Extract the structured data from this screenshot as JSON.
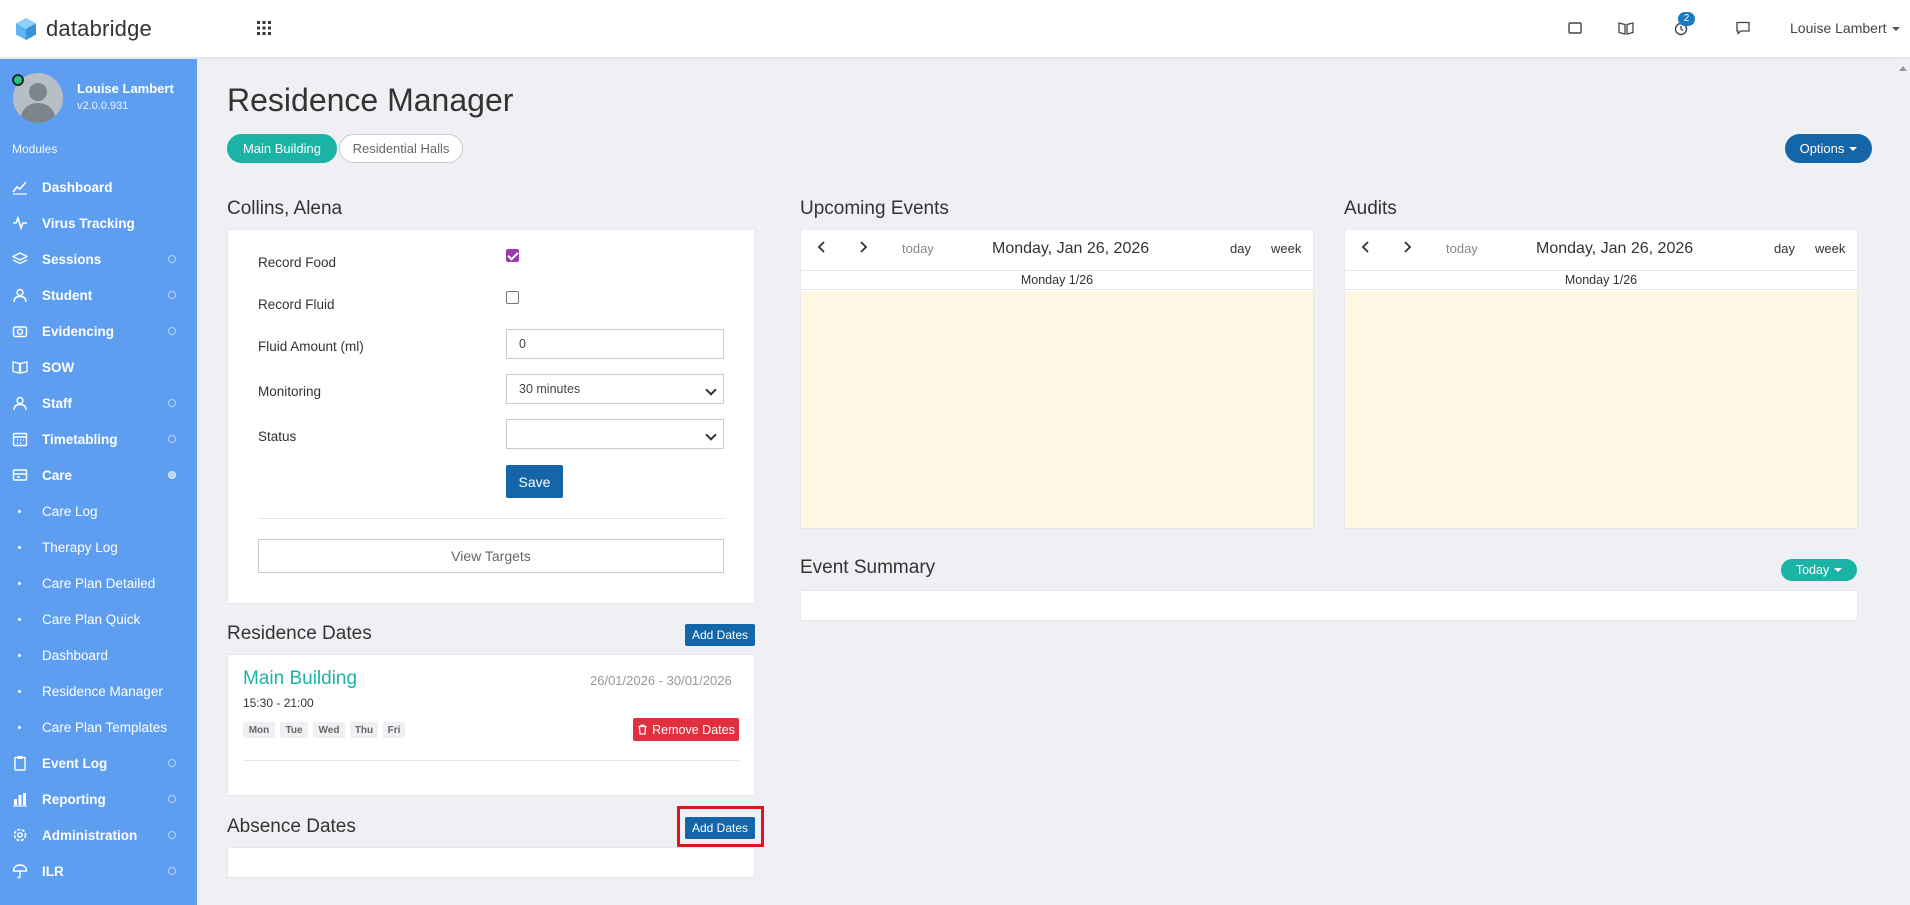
{
  "app": {
    "logo_text": "databridge",
    "top_user": "Louise Lambert",
    "notification_count": "2",
    "accent": "#5e9ef0",
    "primary": "#1466a8",
    "teal": "#1ab3a6",
    "danger": "#e0303f"
  },
  "sidebar": {
    "user_name": "Louise Lambert",
    "version": "v2.0.0.931",
    "section_label": "Modules",
    "items": [
      {
        "label": "Dashboard",
        "icon": "chart-line-icon"
      },
      {
        "label": "Virus Tracking",
        "icon": "pulse-icon"
      },
      {
        "label": "Sessions",
        "icon": "layers-icon"
      },
      {
        "label": "Student",
        "icon": "user-icon"
      },
      {
        "label": "Evidencing",
        "icon": "camera-icon"
      },
      {
        "label": "SOW",
        "icon": "book-icon"
      },
      {
        "label": "Staff",
        "icon": "staff-icon"
      },
      {
        "label": "Timetabling",
        "icon": "calendar-icon"
      },
      {
        "label": "Care",
        "icon": "care-icon"
      }
    ],
    "sub_items": [
      {
        "label": "Care Log"
      },
      {
        "label": "Therapy Log"
      },
      {
        "label": "Care Plan Detailed"
      },
      {
        "label": "Care Plan Quick"
      },
      {
        "label": "Dashboard"
      },
      {
        "label": "Residence Manager"
      },
      {
        "label": "Care Plan Templates"
      }
    ],
    "items_after": [
      {
        "label": "Event Log",
        "icon": "clipboard-icon"
      },
      {
        "label": "Reporting",
        "icon": "bar-chart-icon"
      },
      {
        "label": "Administration",
        "icon": "cog-icon"
      },
      {
        "label": "ILR",
        "icon": "umbrella-icon"
      }
    ]
  },
  "main": {
    "title": "Residence Manager",
    "tabs": [
      {
        "label": "Main Building",
        "active": true
      },
      {
        "label": "Residential Halls",
        "active": false
      }
    ],
    "options_label": "Options"
  },
  "student_form": {
    "title": "Collins, Alena",
    "record_food_label": "Record Food",
    "record_food_checked": true,
    "record_fluid_label": "Record Fluid",
    "record_fluid_checked": false,
    "fluid_amount_label": "Fluid Amount (ml)",
    "fluid_amount_value": "0",
    "monitoring_label": "Monitoring",
    "monitoring_value": "30 minutes",
    "status_label": "Status",
    "status_value": "",
    "save_label": "Save",
    "view_targets_label": "View Targets"
  },
  "residence_dates": {
    "title": "Residence Dates",
    "add_label": "Add Dates",
    "entry": {
      "name": "Main Building",
      "range": "26/01/2026 - 30/01/2026",
      "time": "15:30 - 21:00",
      "days": [
        "Mon",
        "Tue",
        "Wed",
        "Thu",
        "Fri"
      ],
      "remove_label": "Remove Dates"
    }
  },
  "absence_dates": {
    "title": "Absence Dates",
    "add_label": "Add Dates"
  },
  "upcoming_events": {
    "title": "Upcoming Events",
    "today_label": "today",
    "date_title": "Monday, Jan 26, 2026",
    "day_label": "day",
    "week_label": "week",
    "day_header": "Monday 1/26"
  },
  "audits": {
    "title": "Audits",
    "today_label": "today",
    "date_title": "Monday, Jan 26, 2026",
    "day_label": "day",
    "week_label": "week",
    "day_header": "Monday 1/26"
  },
  "event_summary": {
    "title": "Event Summary",
    "filter_label": "Today"
  }
}
